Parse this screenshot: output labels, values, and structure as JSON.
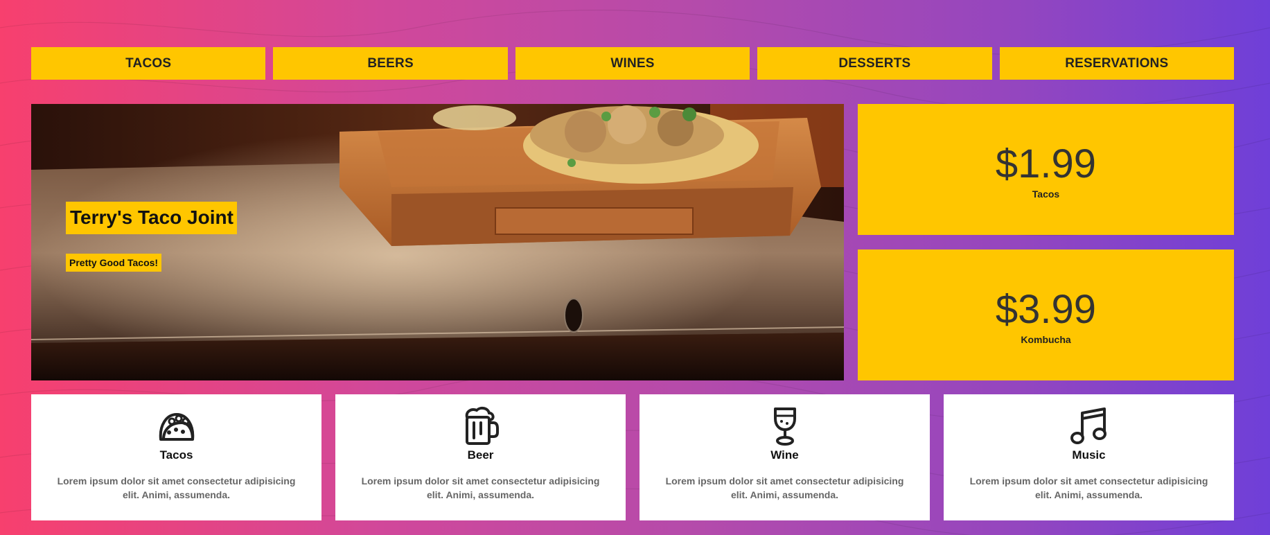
{
  "nav": {
    "items": [
      {
        "label": "TACOS"
      },
      {
        "label": "BEERS"
      },
      {
        "label": "WINES"
      },
      {
        "label": "DESSERTS"
      },
      {
        "label": "RESERVATIONS"
      }
    ]
  },
  "hero": {
    "title": "Terry's Taco Joint",
    "subtitle": "Pretty Good Tacos!"
  },
  "prices": [
    {
      "value": "$1.99",
      "label": "Tacos"
    },
    {
      "value": "$3.99",
      "label": "Kombucha"
    }
  ],
  "features": [
    {
      "icon": "taco-icon",
      "title": "Tacos",
      "text": "Lorem ipsum dolor sit amet consectetur adipisicing elit. Animi, assumenda."
    },
    {
      "icon": "beer-mug-icon",
      "title": "Beer",
      "text": "Lorem ipsum dolor sit amet consectetur adipisicing elit. Animi, assumenda."
    },
    {
      "icon": "wine-glass-icon",
      "title": "Wine",
      "text": "Lorem ipsum dolor sit amet consectetur adipisicing elit. Animi, assumenda."
    },
    {
      "icon": "music-note-icon",
      "title": "Music",
      "text": "Lorem ipsum dolor sit amet consectetur adipisicing elit. Animi, assumenda."
    }
  ],
  "colors": {
    "accent": "#ffc600",
    "gradient_start": "#f7406e",
    "gradient_end": "#6f3fd8",
    "card": "#ffffff"
  }
}
